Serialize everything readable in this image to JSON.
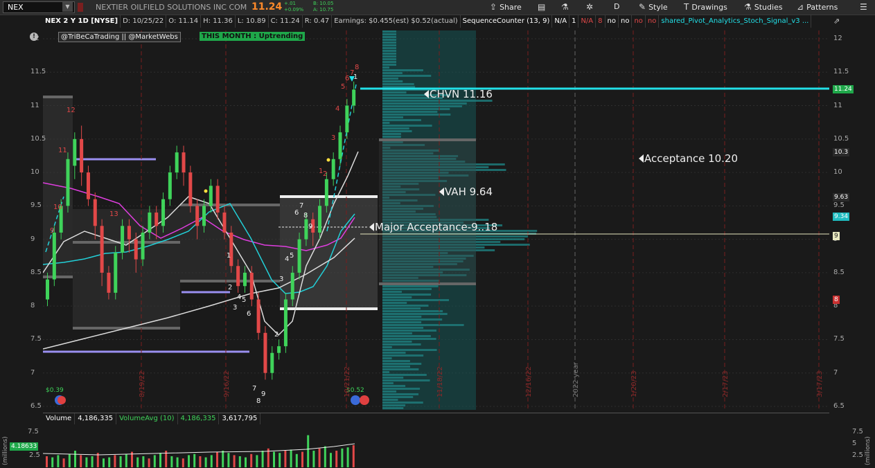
{
  "toolbar": {
    "symbol": "NEX",
    "company": "NEXTIER OILFIELD SOLUTIONS INC COM",
    "last": "11.24",
    "change": "+.01",
    "change_pct": "+0.09%",
    "bid": "B: 10.05",
    "ask": "A: 10.75",
    "share": "Share",
    "period": "D",
    "style": "Style",
    "drawings": "Drawings",
    "studies": "Studies",
    "patterns": "Patterns"
  },
  "header": {
    "title": "NEX 2 Y 1D [NYSE]",
    "date": "D: 10/25/22",
    "open": "O: 11.14",
    "high": "H: 11.36",
    "low": "L: 10.89",
    "close": "C: 11.24",
    "range": "R: 0.47",
    "earnings": "Earnings: $0.455(est) $0.52(actual)",
    "seq_counter": "SequenceCounter (13, 9)",
    "seq_vals": [
      "N/A",
      "1",
      "N/A",
      "8",
      "no",
      "no",
      "no",
      "no"
    ],
    "study": "shared_Pivot_Analytics_Stoch_Signal_v3 ..."
  },
  "tags": {
    "credit": "@TriBeCaTrading || @MarketWebs",
    "month": "THIS MONTH : Uptrending"
  },
  "labels": {
    "chvn": "CHVN 11.16",
    "acceptance": "Acceptance 10.20",
    "vah": "VAH 9.64",
    "major": "Major Acceptance-9..18"
  },
  "y_axis": {
    "ticks": [
      "12",
      "11.5",
      "11",
      "10.5",
      "10",
      "9.5",
      "9",
      "8.5",
      "8",
      "7.5",
      "7",
      "6.5"
    ],
    "badges": [
      {
        "text": "11.24",
        "bg": "#1fa84a",
        "fg": "#ffffff"
      },
      {
        "text": "10.3",
        "bg": "#2a2a2a",
        "fg": "#ffffff"
      },
      {
        "text": "9.63",
        "bg": "#2a2a2a",
        "fg": "#ffffff"
      },
      {
        "text": "9.34",
        "bg": "#1fbcc0",
        "fg": "#ffffff"
      },
      {
        "text": "9",
        "bg": "#e8e8c0",
        "fg": "#222222"
      },
      {
        "text": "8",
        "bg": "#c93030",
        "fg": "#ffffff"
      }
    ]
  },
  "x_axis": {
    "dates": [
      "8/19/22",
      "9/16/22",
      "10/21/22",
      "11/18/22",
      "12/16/22",
      "2022 year",
      "1/20/23",
      "2/17/23",
      "3/17/23"
    ]
  },
  "earnings_marks": [
    "$0.39",
    "$0.52"
  ],
  "volume": {
    "label": "Volume",
    "value": "4,186,335",
    "avg_label": "VolumeAvg (10)",
    "avg_value": "4,186,335",
    "avg_value2": "3,617,795",
    "badge": "4.18633",
    "ticks": [
      "7.5",
      "5",
      "2.5"
    ],
    "unit": "(millions)"
  },
  "colors": {
    "up": "#3fd35a",
    "down": "#e24848",
    "profile": "#1f6b6b",
    "cyan": "#22e0e8"
  }
}
